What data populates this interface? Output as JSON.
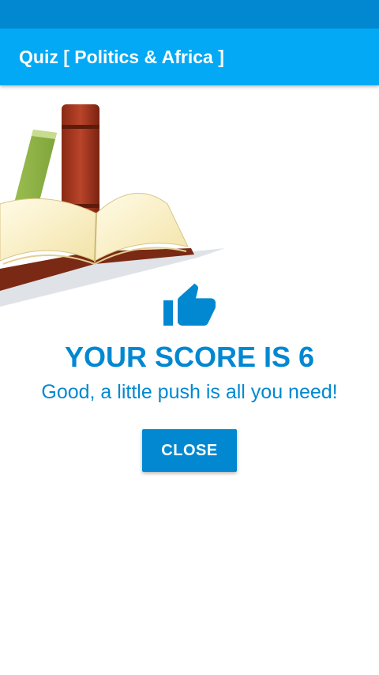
{
  "status_bar": {
    "color": "#0288d1"
  },
  "app_bar": {
    "title": "Quiz [ Politics & Africa ]",
    "color": "#03a9f4"
  },
  "result": {
    "icon": "thumbs-up-icon",
    "score_text": "YOUR SCORE IS 6",
    "message": "Good, a little push is all you need!",
    "accent_color": "#0288d1"
  },
  "actions": {
    "close_label": "CLOSE"
  },
  "illustration": {
    "icon": "books-illustration"
  }
}
